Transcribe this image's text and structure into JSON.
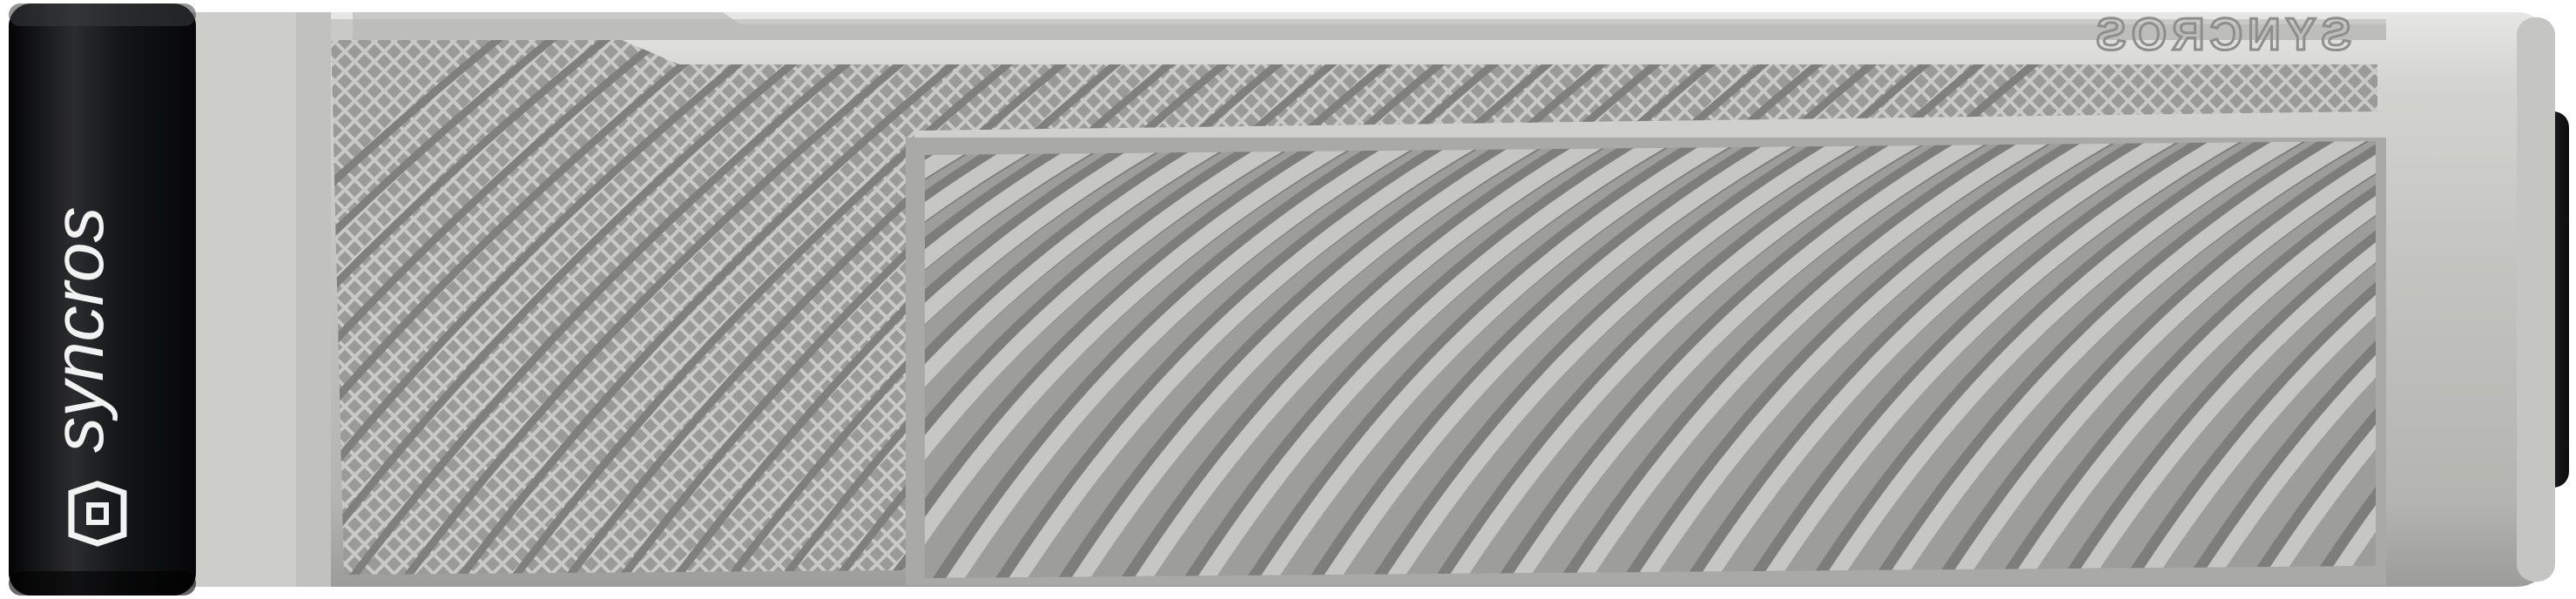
{
  "product": {
    "brand_wordmark": "syncros",
    "molded_wordmark": "SYNCROS"
  },
  "colors": {
    "rubber": "#b9b9b6",
    "rubber_dark": "#8f8f8c",
    "rubber_light": "#d6d6d3",
    "collar": "#111214",
    "collar_highlight": "#3a3b3e",
    "end_cap": "#222326",
    "background": "#ffffff"
  }
}
